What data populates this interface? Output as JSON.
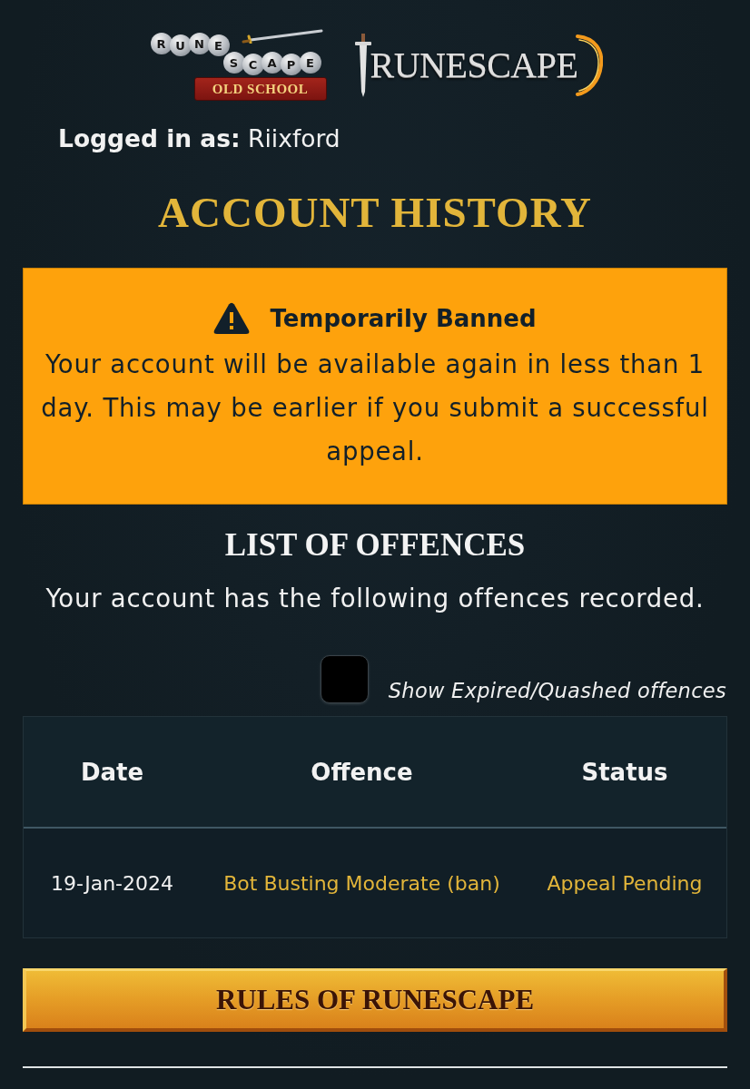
{
  "logos": [
    {
      "kind": "old_school",
      "upper_rocks": [
        "R",
        "U",
        "N",
        "E"
      ],
      "lower_rocks": [
        "S",
        "C",
        "A",
        "P",
        "E"
      ],
      "banner": "OLD SCHOOL"
    },
    {
      "kind": "main",
      "text": "RUNESCAPE"
    }
  ],
  "login": {
    "label": "Logged in as:",
    "user": "Riixford"
  },
  "title": "ACCOUNT HISTORY",
  "alert": {
    "kind": "warning",
    "title": "Temporarily Banned",
    "message": "Your account will be available again in less than 1 day. This may be earlier if you submit a successful appeal."
  },
  "offences": {
    "heading": "LIST OF OFFENCES",
    "intro": "Your account has the following offences recorded.",
    "filter": {
      "label": "Show Expired/Quashed offences",
      "checked": false
    },
    "table": {
      "columns": [
        "Date",
        "Offence",
        "Status"
      ],
      "rows": [
        [
          "19-Jan-2024",
          "Bot Busting Moderate (ban)",
          "Appeal Pending"
        ]
      ]
    }
  },
  "button": "RULES OF RUNESCAPE"
}
